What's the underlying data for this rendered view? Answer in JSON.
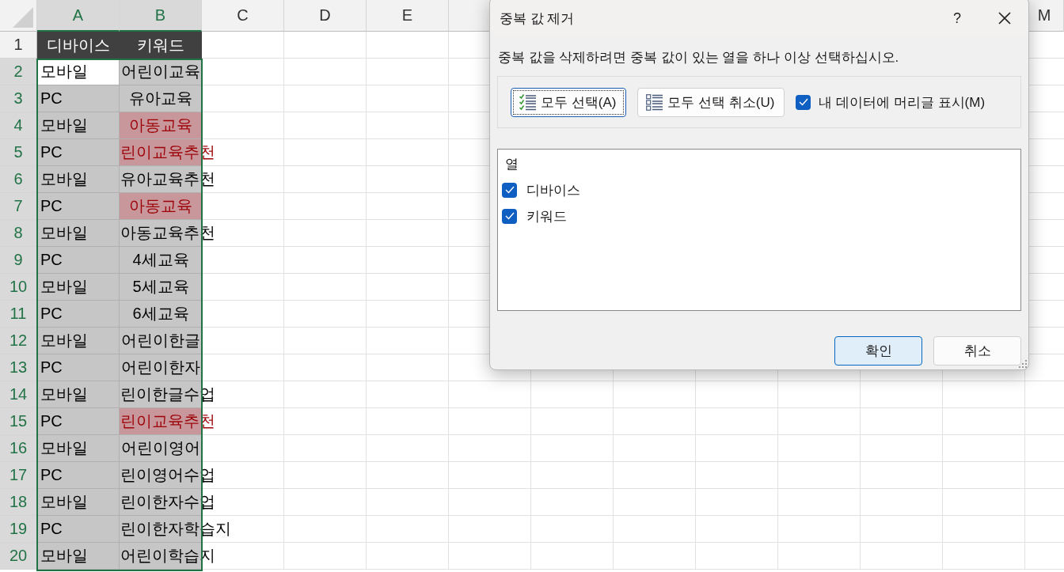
{
  "sheet": {
    "columns": [
      {
        "label": "A",
        "selected": true
      },
      {
        "label": "B",
        "selected": true
      },
      {
        "label": "C",
        "selected": false
      },
      {
        "label": "D",
        "selected": false
      },
      {
        "label": "E",
        "selected": false
      },
      {
        "label": "M",
        "selected": false
      }
    ],
    "header_row": {
      "number": "1",
      "selected": false,
      "cells": [
        "디바이스",
        "키워드"
      ]
    },
    "rows": [
      {
        "number": "2",
        "selected": true,
        "device": "모바일",
        "keyword": "어린이교육",
        "active": true,
        "duplicate": false
      },
      {
        "number": "3",
        "selected": true,
        "device": "PC",
        "keyword": "유아교육",
        "active": false,
        "duplicate": false
      },
      {
        "number": "4",
        "selected": true,
        "device": "모바일",
        "keyword": "아동교육",
        "active": false,
        "duplicate": true
      },
      {
        "number": "5",
        "selected": true,
        "device": "PC",
        "keyword": "린이교육추천",
        "active": false,
        "duplicate": true
      },
      {
        "number": "6",
        "selected": true,
        "device": "모바일",
        "keyword": "유아교육추천",
        "active": false,
        "duplicate": false
      },
      {
        "number": "7",
        "selected": true,
        "device": "PC",
        "keyword": "아동교육",
        "active": false,
        "duplicate": true
      },
      {
        "number": "8",
        "selected": true,
        "device": "모바일",
        "keyword": "아동교육추천",
        "active": false,
        "duplicate": false
      },
      {
        "number": "9",
        "selected": true,
        "device": "PC",
        "keyword": "4세교육",
        "active": false,
        "duplicate": false
      },
      {
        "number": "10",
        "selected": true,
        "device": "모바일",
        "keyword": "5세교육",
        "active": false,
        "duplicate": false
      },
      {
        "number": "11",
        "selected": true,
        "device": "PC",
        "keyword": "6세교육",
        "active": false,
        "duplicate": false
      },
      {
        "number": "12",
        "selected": true,
        "device": "모바일",
        "keyword": "어린이한글",
        "active": false,
        "duplicate": false
      },
      {
        "number": "13",
        "selected": true,
        "device": "PC",
        "keyword": "어린이한자",
        "active": false,
        "duplicate": false
      },
      {
        "number": "14",
        "selected": true,
        "device": "모바일",
        "keyword": "린이한글수업",
        "active": false,
        "duplicate": false
      },
      {
        "number": "15",
        "selected": true,
        "device": "PC",
        "keyword": "린이교육추천",
        "active": false,
        "duplicate": true
      },
      {
        "number": "16",
        "selected": true,
        "device": "모바일",
        "keyword": "어린이영어",
        "active": false,
        "duplicate": false
      },
      {
        "number": "17",
        "selected": true,
        "device": "PC",
        "keyword": "린이영어수업",
        "active": false,
        "duplicate": false
      },
      {
        "number": "18",
        "selected": true,
        "device": "모바일",
        "keyword": "린이한자수업",
        "active": false,
        "duplicate": false
      },
      {
        "number": "19",
        "selected": true,
        "device": "PC",
        "keyword": "린이한자학습지",
        "active": false,
        "duplicate": false
      },
      {
        "number": "20",
        "selected": true,
        "device": "모바일",
        "keyword": "어린이학습지",
        "active": false,
        "duplicate": false
      }
    ]
  },
  "dialog": {
    "title": "중복 값 제거",
    "help": "?",
    "instruction": "중복 값을 삭제하려면 중복 값이 있는 열을 하나 이상 선택하십시오.",
    "select_all": "모두 선택(A)",
    "unselect_all": "모두 선택 취소(U)",
    "header_checkbox": {
      "label": "내 데이터에 머리글 표시(M)",
      "checked": true
    },
    "list": {
      "heading": "열",
      "items": [
        {
          "label": "디바이스",
          "checked": true
        },
        {
          "label": "키워드",
          "checked": true
        }
      ]
    },
    "buttons": [
      {
        "label": "확인",
        "kind": "primary"
      },
      {
        "label": "취소",
        "kind": "secondary"
      }
    ]
  }
}
